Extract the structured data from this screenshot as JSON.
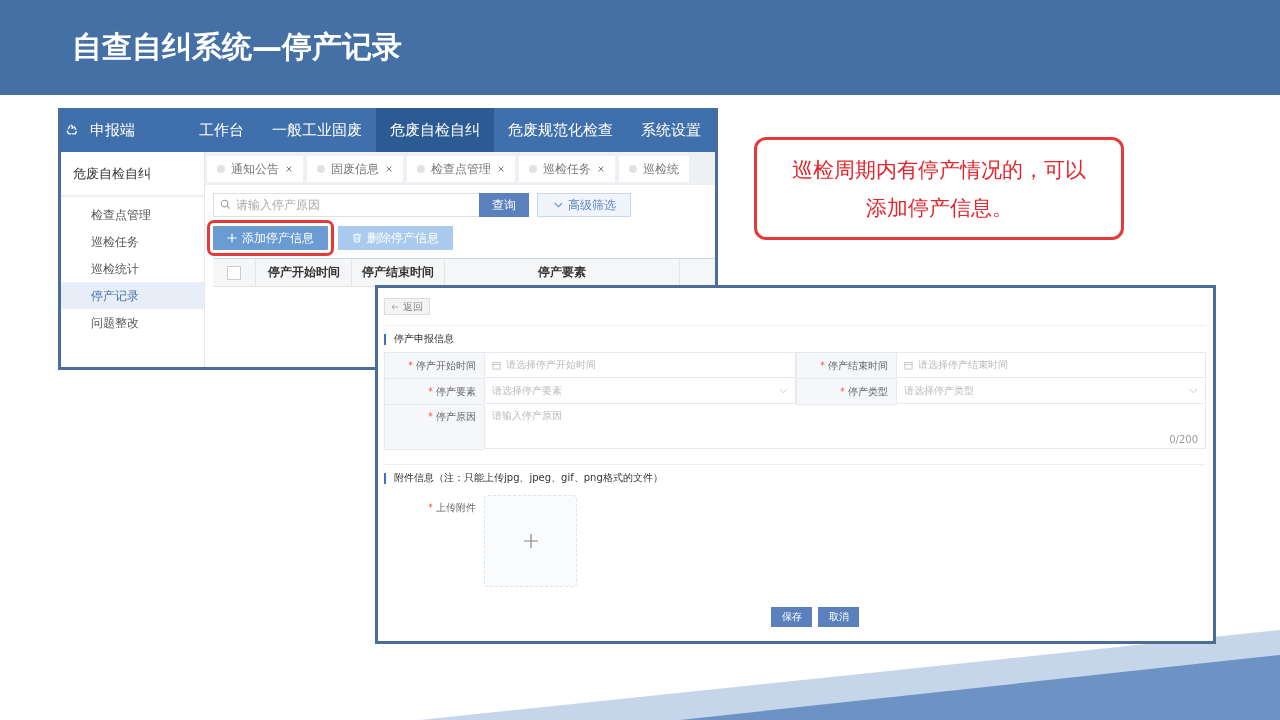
{
  "slide": {
    "title": "自查自纠系统—停产记录"
  },
  "callout": {
    "lines": [
      "巡检周期内有停产情况的，可以",
      "添加停产信息。"
    ]
  },
  "list_screen": {
    "app_name": "申报端",
    "nav": [
      {
        "label": "工作台",
        "selected": false
      },
      {
        "label": "一般工业固废",
        "selected": false
      },
      {
        "label": "危废自检自纠",
        "selected": true
      },
      {
        "label": "危废规范化检查",
        "selected": false
      },
      {
        "label": "系统设置",
        "selected": false
      }
    ],
    "sidebar": {
      "title": "危废自检自纠",
      "items": [
        {
          "label": "检查点管理",
          "selected": false
        },
        {
          "label": "巡检任务",
          "selected": false
        },
        {
          "label": "巡检统计",
          "selected": false
        },
        {
          "label": "停产记录",
          "selected": true
        },
        {
          "label": "问题整改",
          "selected": false
        }
      ]
    },
    "tabs": [
      {
        "label": "通知公告",
        "closable": true
      },
      {
        "label": "固废信息",
        "closable": true
      },
      {
        "label": "检查点管理",
        "closable": true
      },
      {
        "label": "巡检任务",
        "closable": true
      },
      {
        "label": "巡检统",
        "closable": false
      }
    ],
    "search": {
      "placeholder": "请输入停产原因"
    },
    "search_button": "查询",
    "filter_button": "高级筛选",
    "add_button": {
      "label": "添加停产信息",
      "highlighted": true
    },
    "delete_button": {
      "label": "删除停产信息",
      "disabled": true
    },
    "table": {
      "select_all_checked": false,
      "columns": [
        "停产开始时间",
        "停产结束时间",
        "停产要素"
      ]
    }
  },
  "form_screen": {
    "back_button": "返回",
    "section_1": {
      "title": "停产申报信息",
      "fields": [
        {
          "kind": "date",
          "label": "停产开始时间",
          "required": true,
          "placeholder": "请选择停产开始时间"
        },
        {
          "kind": "date",
          "label": "停产结束时间",
          "required": true,
          "placeholder": "请选择停产结束时间"
        },
        {
          "kind": "select",
          "label": "停产要素",
          "required": true,
          "placeholder": "请选择停产要素"
        },
        {
          "kind": "select",
          "label": "停产类型",
          "required": true,
          "placeholder": "请选择停产类型"
        },
        {
          "kind": "textarea",
          "label": "停产原因",
          "required": true,
          "placeholder": "请输入停产原因",
          "counter": "0/200"
        }
      ]
    },
    "section_2": {
      "title": "附件信息（注：只能上传jpg、jpeg、gif、png格式的文件）",
      "upload": {
        "label": "上传附件",
        "required": true
      }
    },
    "buttons": [
      "保存",
      "取消"
    ]
  }
}
